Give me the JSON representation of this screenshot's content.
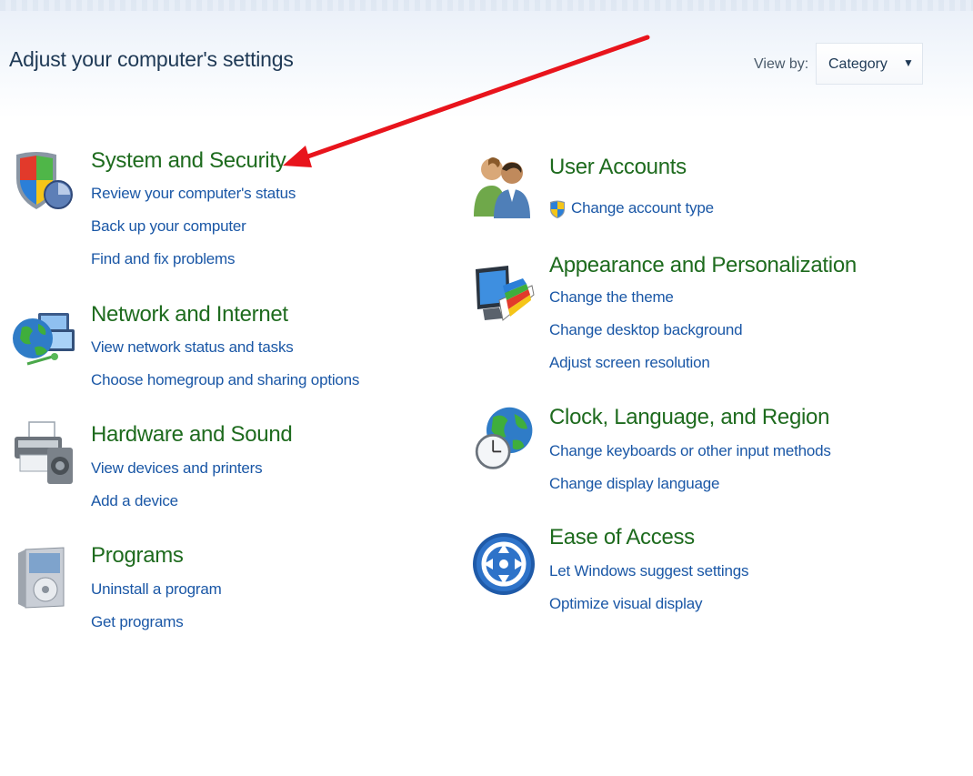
{
  "header": {
    "title": "Adjust your computer's settings",
    "view_by_label": "View by:",
    "view_by_value": "Category"
  },
  "categories": {
    "system_security": {
      "title": "System and Security",
      "icon": "shield-icon",
      "links": [
        "Review your computer's status",
        "Back up your computer",
        "Find and fix problems"
      ]
    },
    "network_internet": {
      "title": "Network and Internet",
      "icon": "network-globe-icon",
      "links": [
        "View network status and tasks",
        "Choose homegroup and sharing options"
      ]
    },
    "hardware_sound": {
      "title": "Hardware and Sound",
      "icon": "printer-speaker-icon",
      "links": [
        "View devices and printers",
        "Add a device"
      ]
    },
    "programs": {
      "title": "Programs",
      "icon": "software-box-icon",
      "links": [
        "Uninstall a program",
        "Get programs"
      ]
    },
    "user_accounts": {
      "title": "User Accounts",
      "icon": "users-icon",
      "links": [
        "Change account type"
      ]
    },
    "appearance": {
      "title": "Appearance and Personalization",
      "icon": "monitor-palette-icon",
      "links": [
        "Change the theme",
        "Change desktop background",
        "Adjust screen resolution"
      ]
    },
    "clock_language": {
      "title": "Clock, Language, and Region",
      "icon": "globe-clock-icon",
      "links": [
        "Change keyboards or other input methods",
        "Change display language"
      ]
    },
    "ease_of_access": {
      "title": "Ease of Access",
      "icon": "ease-of-access-icon",
      "links": [
        "Let Windows suggest settings",
        "Optimize visual display"
      ]
    }
  },
  "colors": {
    "category_title": "#1e6b1e",
    "link": "#1a57a6",
    "annotation_arrow": "#e8141c"
  }
}
